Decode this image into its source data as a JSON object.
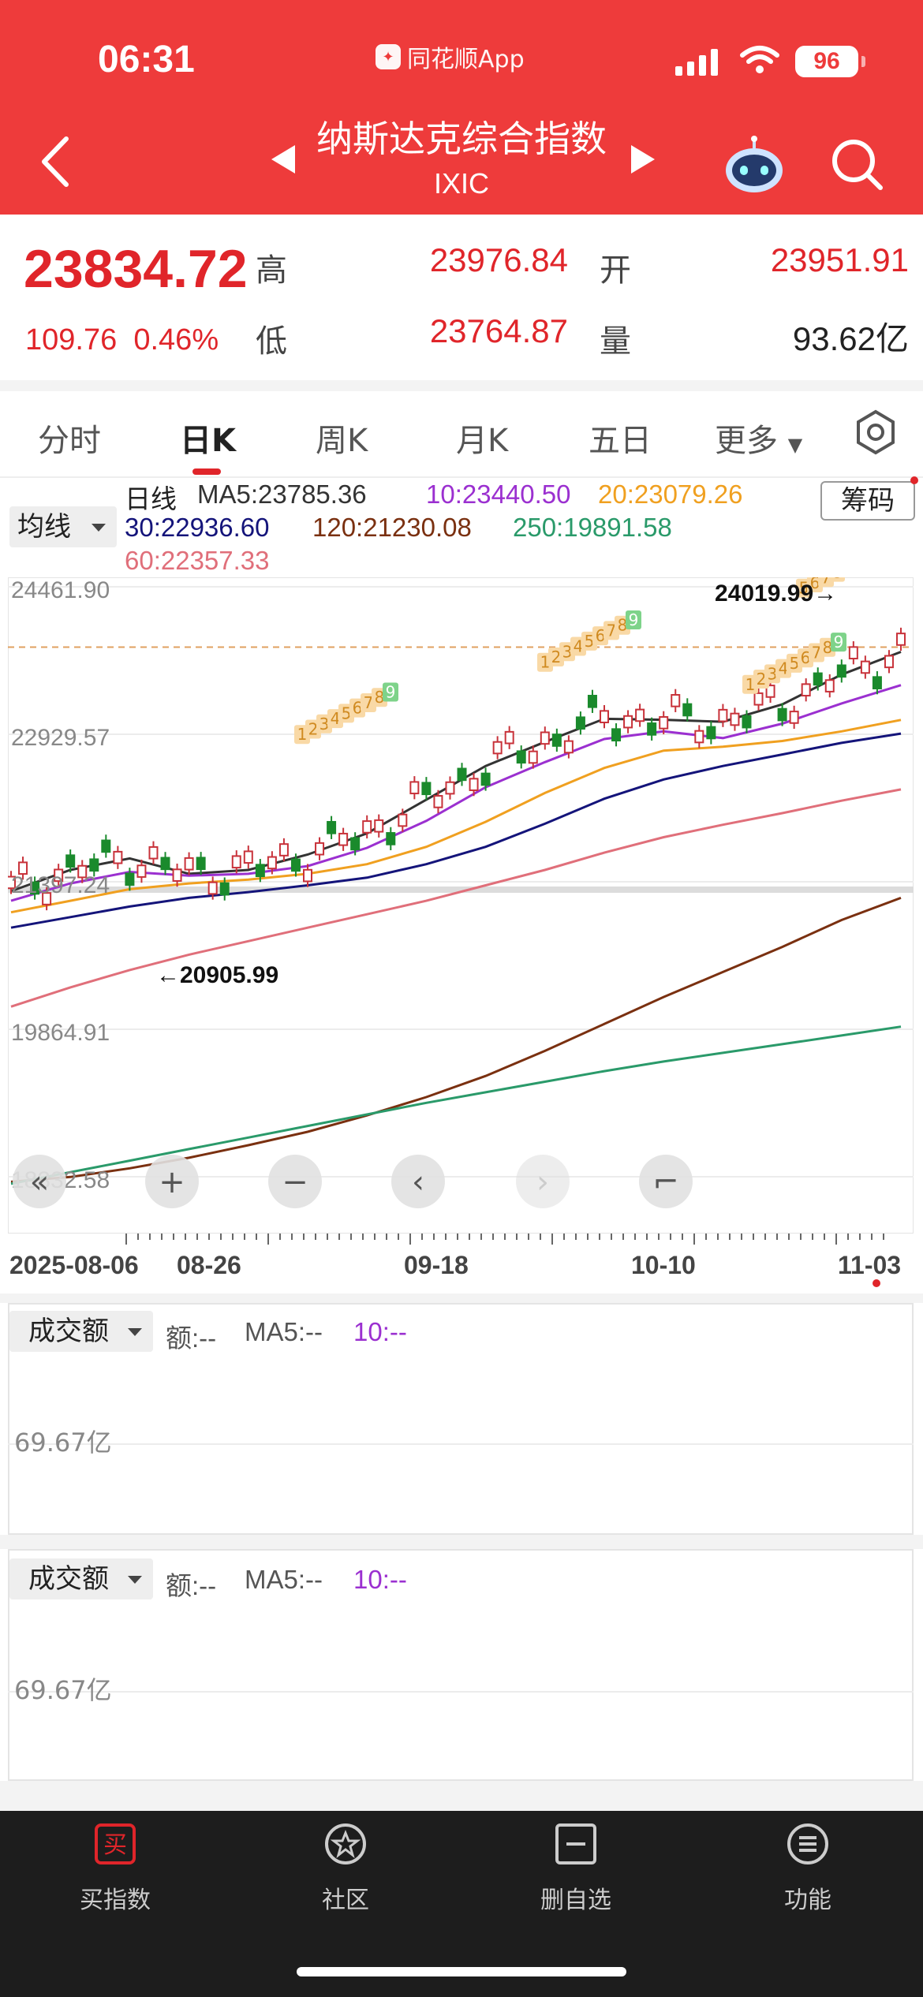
{
  "status_bar": {
    "time": "06:31",
    "app_name": "同花顺App",
    "battery": "96"
  },
  "header": {
    "title": "纳斯达克综合指数",
    "subtitle": "IXIC"
  },
  "quote": {
    "price": "23834.72",
    "change": "109.76",
    "change_pct": "0.46%",
    "high_label": "高",
    "high": "23976.84",
    "open_label": "开",
    "open": "23951.91",
    "low_label": "低",
    "low": "23764.87",
    "volume_label": "量",
    "volume": "93.62亿"
  },
  "tabs": [
    "分时",
    "日K",
    "周K",
    "月K",
    "五日",
    "更多"
  ],
  "active_tab": "日K",
  "ma_legend": {
    "selector": "均线",
    "period": "日线",
    "ma5": "MA5:23785.36",
    "ma10": "10:23440.50",
    "ma20": "20:23079.26",
    "ma30": "30:22936.60",
    "ma120": "120:21230.08",
    "ma250": "250:19891.58",
    "ma60": "60:22357.33",
    "chip_button": "筹码"
  },
  "colors": {
    "up": "#c8323a",
    "down": "#1a8a2c",
    "ma5": "#333333",
    "ma10": "#9b30d0",
    "ma20": "#f0a020",
    "ma30": "#14147a",
    "ma60": "#e06f7a",
    "ma120": "#7a3010",
    "ma250": "#2a9a6a"
  },
  "chart_data": {
    "type": "candlestick",
    "y_ticks": [
      "24461.90",
      "22929.57",
      "21397.24",
      "19864.91",
      "18332.58"
    ],
    "ylim": [
      18332.58,
      24461.9
    ],
    "x_labels": [
      "2025-08-06",
      "08-26",
      "09-18",
      "10-10",
      "11-03"
    ],
    "max_label": "24019.99→",
    "min_label": "←20905.99",
    "td_counts_visible": [
      "1",
      "2",
      "3",
      "4",
      "5",
      "6",
      "7",
      "8",
      "9"
    ],
    "series": [
      {
        "name": "MA5",
        "values": [
          21300,
          21520,
          21640,
          21480,
          21520,
          21680,
          21900,
          22250,
          22600,
          22850,
          23090,
          23080,
          23060,
          23240,
          23550,
          23786
        ]
      },
      {
        "name": "MA10",
        "values": [
          21200,
          21380,
          21500,
          21460,
          21480,
          21560,
          21750,
          22030,
          22380,
          22640,
          22880,
          22960,
          22890,
          23040,
          23250,
          23440
        ]
      },
      {
        "name": "MA20",
        "values": [
          21080,
          21200,
          21320,
          21380,
          21420,
          21480,
          21580,
          21760,
          22020,
          22320,
          22580,
          22760,
          22800,
          22860,
          22960,
          23079
        ]
      },
      {
        "name": "MA30",
        "values": [
          20920,
          21030,
          21140,
          21230,
          21290,
          21360,
          21440,
          21580,
          21760,
          22000,
          22260,
          22460,
          22600,
          22720,
          22840,
          22937
        ]
      },
      {
        "name": "MA60",
        "values": [
          20100,
          20300,
          20480,
          20640,
          20780,
          20920,
          21060,
          21200,
          21360,
          21520,
          21700,
          21860,
          21990,
          22110,
          22240,
          22357
        ]
      },
      {
        "name": "MA120",
        "values": [
          18280,
          18330,
          18420,
          18530,
          18660,
          18800,
          18970,
          19160,
          19380,
          19640,
          19920,
          20200,
          20460,
          20720,
          21000,
          21230
        ]
      },
      {
        "name": "MA250",
        "values": [
          18260,
          18380,
          18500,
          18620,
          18740,
          18860,
          18980,
          19100,
          19210,
          19320,
          19430,
          19530,
          19620,
          19710,
          19800,
          19892
        ]
      }
    ]
  },
  "chart_controls": [
    "«",
    "+",
    "−",
    "‹",
    "›",
    "⌐"
  ],
  "volume_panels": [
    {
      "selector": "成交额",
      "amount": "额:--",
      "ma5": "MA5:--",
      "ma10": "10:--",
      "value": "69.67亿"
    },
    {
      "selector": "成交额",
      "amount": "额:--",
      "ma5": "MA5:--",
      "ma10": "10:--",
      "value": "69.67亿"
    }
  ],
  "bottom_nav": [
    {
      "label": "买指数",
      "icon": "buy-icon",
      "glyph": "买"
    },
    {
      "label": "社区",
      "icon": "community-icon",
      "glyph": "★"
    },
    {
      "label": "删自选",
      "icon": "remove-watchlist-icon",
      "glyph": "−"
    },
    {
      "label": "功能",
      "icon": "menu-icon",
      "glyph": "≡"
    }
  ]
}
